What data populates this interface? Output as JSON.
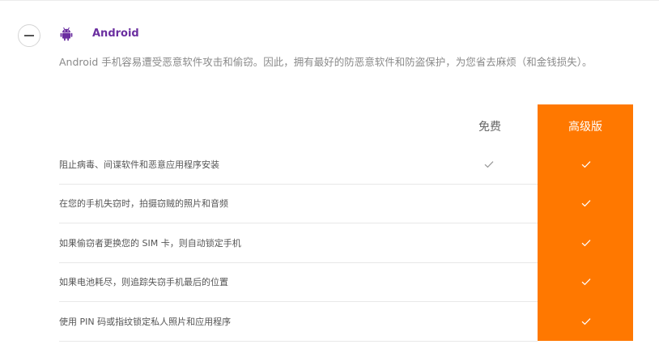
{
  "section": {
    "title": "Android",
    "description": "Android 手机容易遭受恶意软件攻击和偷窃。因此，拥有最好的防恶意软件和防盗保护，为您省去麻烦（和金钱损失）。",
    "icon": "android-icon",
    "collapse_icon": "minus-icon"
  },
  "columns": {
    "free": "免费",
    "premium": "高级版"
  },
  "features": [
    {
      "label": "阻止病毒、间谍软件和恶意应用程序安装",
      "free": true,
      "premium": true
    },
    {
      "label": "在您的手机失窃时，拍摄窃贼的照片和音频",
      "free": false,
      "premium": true
    },
    {
      "label": "如果偷窃者更换您的 SIM 卡，则自动锁定手机",
      "free": false,
      "premium": true
    },
    {
      "label": "如果电池耗尽，则追踪失窃手机最后的位置",
      "free": false,
      "premium": true
    },
    {
      "label": "使用 PIN 码或指纹锁定私人照片和应用程序",
      "free": false,
      "premium": true
    }
  ],
  "colors": {
    "title": "#6b2fa0",
    "premium_bg": "#ff7800",
    "check_free": "#9a9a9a",
    "check_premium": "#ffffff"
  }
}
